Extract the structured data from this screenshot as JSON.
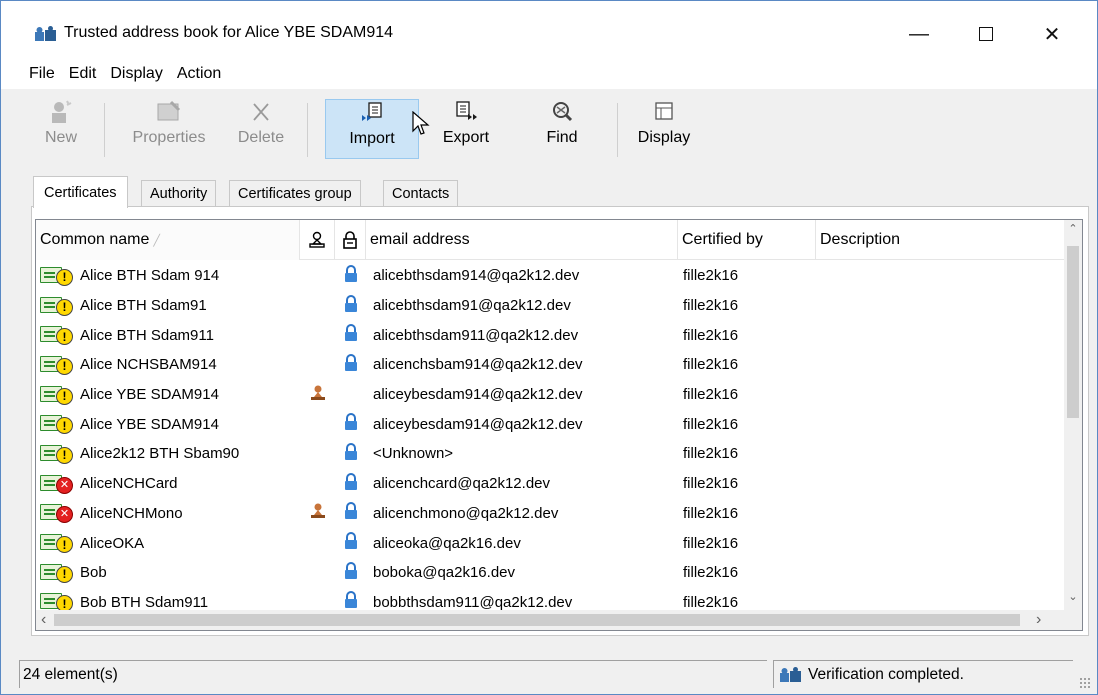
{
  "window": {
    "title": "Trusted address book for Alice YBE SDAM914",
    "controls": {
      "minimize": "—",
      "close": "✕"
    }
  },
  "menu": [
    "File",
    "Edit",
    "Display",
    "Action"
  ],
  "toolbar": {
    "new": "New",
    "properties": "Properties",
    "delete": "Delete",
    "import": "Import",
    "export": "Export",
    "find": "Find",
    "display": "Display"
  },
  "tabs": [
    "Certificates",
    "Authority",
    "Certificates group",
    "Contacts"
  ],
  "columns": {
    "common_name": "Common name",
    "email": "email address",
    "certified_by": "Certified by",
    "description": "Description"
  },
  "rows": [
    {
      "name": "Alice BTH Sdam 914",
      "status": "warning",
      "seal": false,
      "lock": true,
      "email": "alicebthsdam914@qa2k12.dev",
      "certified_by": "fille2k16"
    },
    {
      "name": "Alice BTH Sdam91",
      "status": "warning",
      "seal": false,
      "lock": true,
      "email": "alicebthsdam91@qa2k12.dev",
      "certified_by": "fille2k16"
    },
    {
      "name": "Alice BTH Sdam911",
      "status": "warning",
      "seal": false,
      "lock": true,
      "email": "alicebthsdam911@qa2k12.dev",
      "certified_by": "fille2k16"
    },
    {
      "name": "Alice NCHSBAM914",
      "status": "warning",
      "seal": false,
      "lock": true,
      "email": "alicenchsbam914@qa2k12.dev",
      "certified_by": "fille2k16"
    },
    {
      "name": "Alice YBE SDAM914",
      "status": "warning",
      "seal": true,
      "lock": false,
      "email": "aliceybesdam914@qa2k12.dev",
      "certified_by": "fille2k16"
    },
    {
      "name": "Alice YBE SDAM914",
      "status": "warning",
      "seal": false,
      "lock": true,
      "email": "aliceybesdam914@qa2k12.dev",
      "certified_by": "fille2k16"
    },
    {
      "name": "Alice2k12 BTH Sbam90",
      "status": "warning",
      "seal": false,
      "lock": true,
      "email": "<Unknown>",
      "certified_by": "fille2k16"
    },
    {
      "name": "AliceNCHCard",
      "status": "error",
      "seal": false,
      "lock": true,
      "email": "alicenchcard@qa2k12.dev",
      "certified_by": "fille2k16"
    },
    {
      "name": "AliceNCHMono",
      "status": "error",
      "seal": true,
      "lock": true,
      "email": "alicenchmono@qa2k12.dev",
      "certified_by": "fille2k16"
    },
    {
      "name": "AliceOKA",
      "status": "warning",
      "seal": false,
      "lock": true,
      "email": "aliceoka@qa2k16.dev",
      "certified_by": "fille2k16"
    },
    {
      "name": "Bob",
      "status": "warning",
      "seal": false,
      "lock": true,
      "email": "boboka@qa2k16.dev",
      "certified_by": "fille2k16"
    },
    {
      "name": "Bob BTH Sdam911",
      "status": "warning",
      "seal": false,
      "lock": true,
      "email": "bobbthsdam911@qa2k12.dev",
      "certified_by": "fille2k16"
    }
  ],
  "status": {
    "count": "24 element(s)",
    "message": "Verification completed."
  }
}
